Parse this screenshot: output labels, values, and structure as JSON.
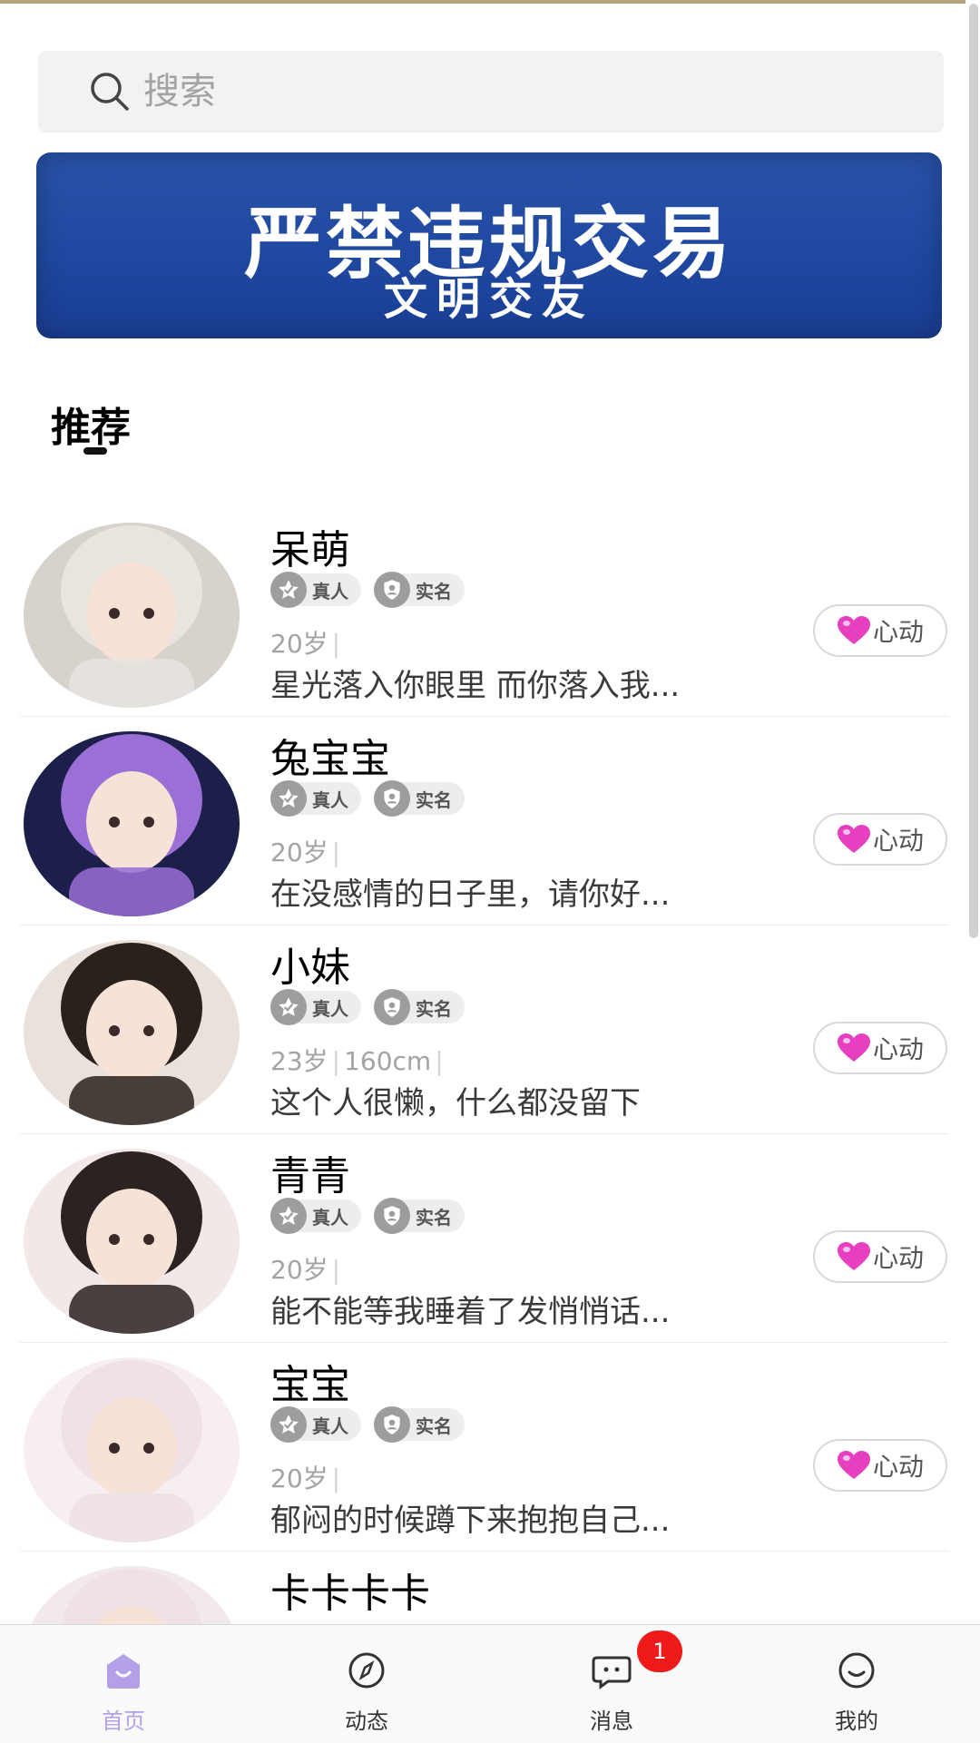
{
  "search": {
    "placeholder": "搜索"
  },
  "banner": {
    "title": "严禁违规交易",
    "subtitle": "文明交友"
  },
  "section": {
    "title": "推荐"
  },
  "badges": {
    "real": "真人",
    "verified": "实名"
  },
  "like_label": "心动",
  "users": [
    {
      "name": "呆萌",
      "meta": [
        "20岁"
      ],
      "bio": "星光落入你眼里 而你落入我...",
      "avatar_bg": "#d7d2cc"
    },
    {
      "name": "兔宝宝",
      "meta": [
        "20岁"
      ],
      "bio": "在没感情的日子里，请你好...",
      "avatar_bg": "#1b1f4a"
    },
    {
      "name": "小妹",
      "meta": [
        "23岁",
        "160cm"
      ],
      "bio": "这个人很懒，什么都没留下",
      "avatar_bg": "#e9e2dc"
    },
    {
      "name": "青青",
      "meta": [
        "20岁"
      ],
      "bio": "能不能等我睡着了发悄悄话...",
      "avatar_bg": "#f3e8e8"
    },
    {
      "name": "宝宝",
      "meta": [
        "20岁"
      ],
      "bio": "郁闷的时候蹲下来抱抱自己...",
      "avatar_bg": "#f6eef2"
    },
    {
      "name": "卡卡卡卡",
      "meta": [],
      "bio": "",
      "avatar_bg": "#f1e9ee"
    }
  ],
  "tabs": [
    {
      "label": "首页",
      "icon": "home-icon",
      "active": true
    },
    {
      "label": "动态",
      "icon": "compass-icon",
      "active": false
    },
    {
      "label": "消息",
      "icon": "message-icon",
      "active": false,
      "badge": "1"
    },
    {
      "label": "我的",
      "icon": "smile-icon",
      "active": false
    }
  ],
  "colors": {
    "accent": "#b4a0e6",
    "badge_red": "#ef1b1b",
    "banner_blue": "#1f48a0",
    "heart_pink": "#e63fbf"
  }
}
